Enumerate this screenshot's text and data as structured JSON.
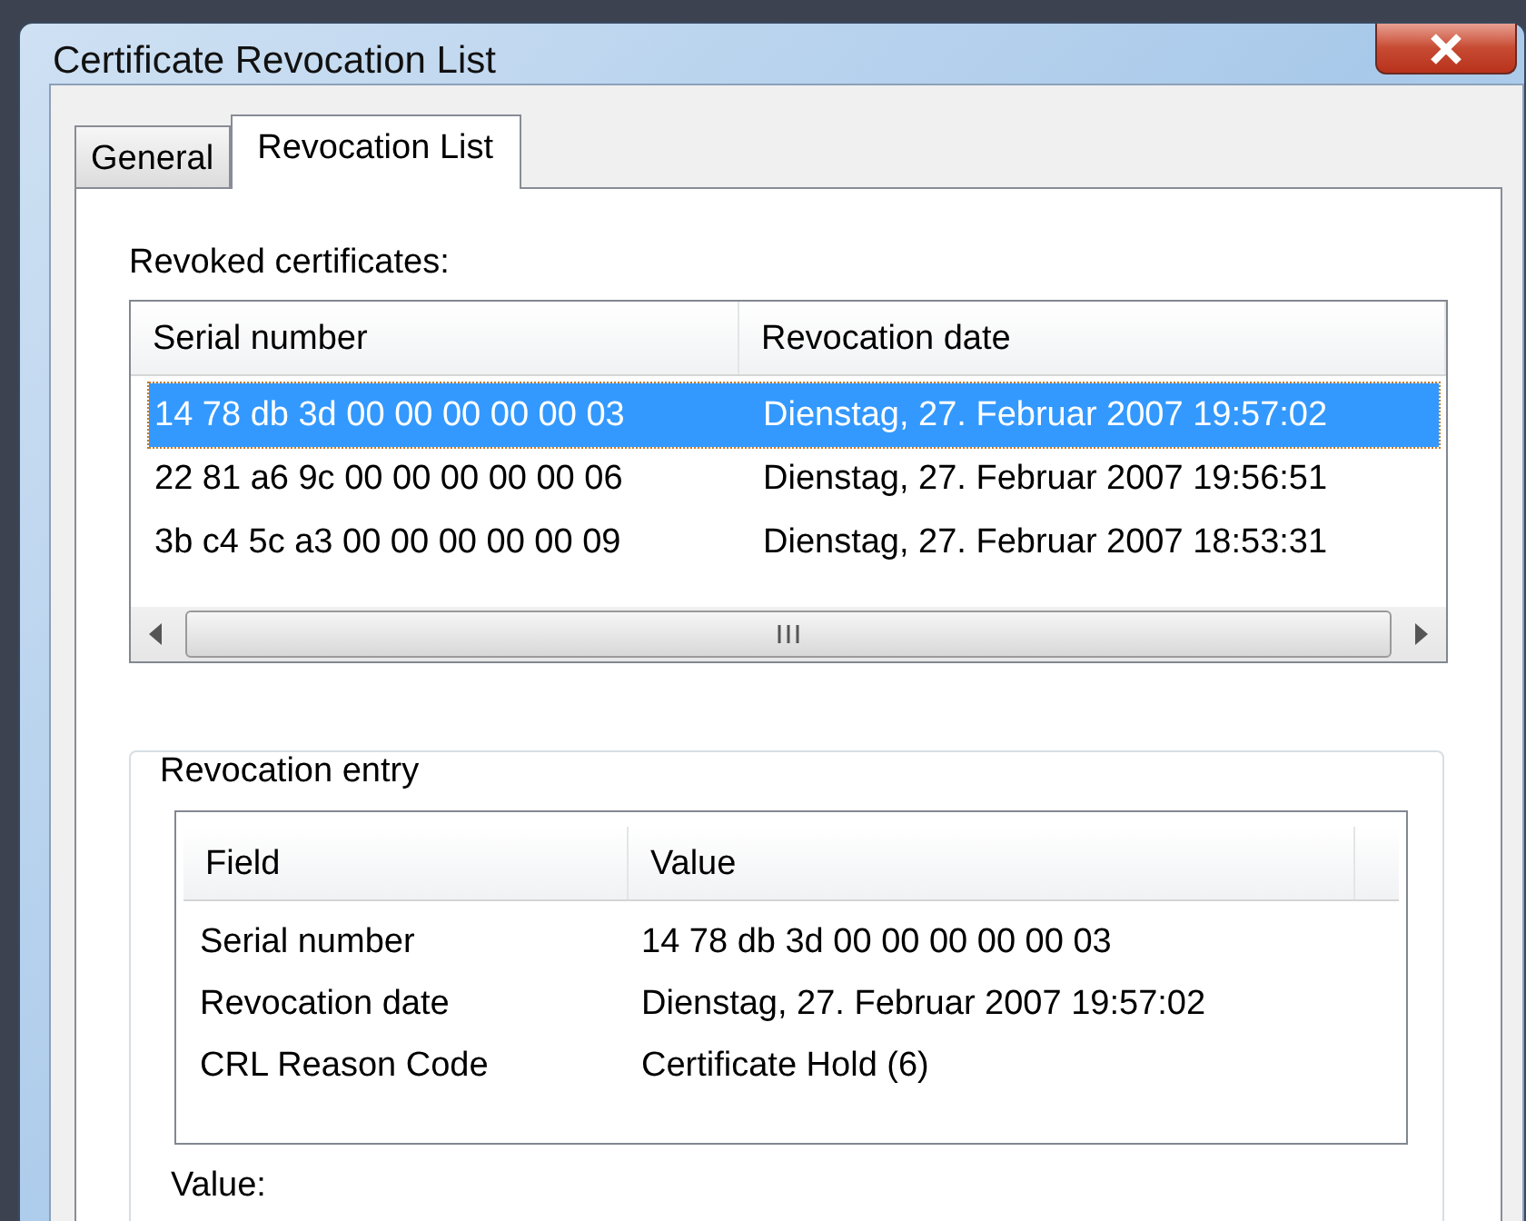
{
  "window": {
    "title": "Certificate Revocation List"
  },
  "tabs": [
    {
      "label": "General",
      "selected": false
    },
    {
      "label": "Revocation List",
      "selected": true
    }
  ],
  "revoked_certificates": {
    "label": "Revoked certificates:",
    "columns": [
      "Serial number",
      "Revocation date"
    ],
    "rows": [
      {
        "serial_number": "14 78 db 3d 00 00 00 00 00 03",
        "revocation_date": "Dienstag, 27. Februar 2007 19:57:02",
        "selected": true
      },
      {
        "serial_number": "22 81 a6 9c 00 00 00 00 00 06",
        "revocation_date": "Dienstag, 27. Februar 2007 19:56:51",
        "selected": false
      },
      {
        "serial_number": "3b c4 5c a3 00 00 00 00 00 09",
        "revocation_date": "Dienstag, 27. Februar 2007 18:53:31",
        "selected": false
      }
    ]
  },
  "revocation_entry": {
    "title": "Revocation entry",
    "columns": [
      "Field",
      "Value"
    ],
    "rows": [
      {
        "field": "Serial number",
        "value": "14 78 db 3d 00 00 00 00 00 03"
      },
      {
        "field": "Revocation date",
        "value": "Dienstag, 27. Februar 2007 19:57:02"
      },
      {
        "field": "CRL Reason Code",
        "value": "Certificate Hold (6)"
      }
    ]
  },
  "value_label": "Value:"
}
